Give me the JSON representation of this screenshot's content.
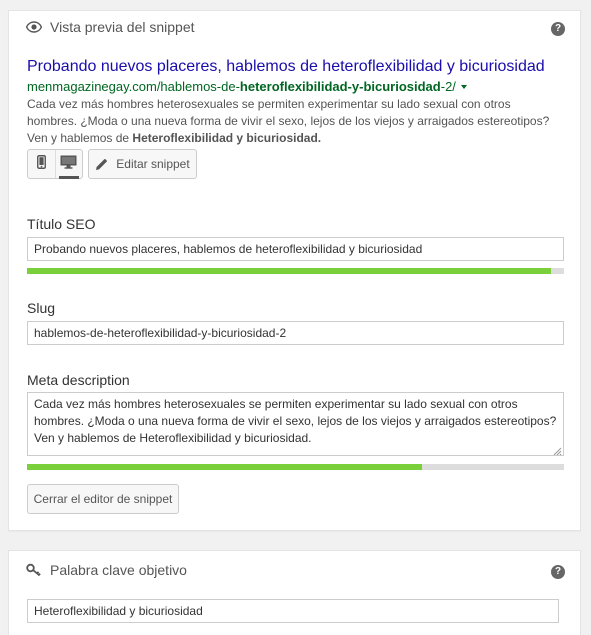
{
  "snippet_preview": {
    "header": "Vista previa del snippet",
    "help_label": "?",
    "title": "Probando nuevos placeres, hablemos de heteroflexibilidad y bicuriosidad",
    "url_prefix": "menmagazinegay.com/hablemos-de-",
    "url_bold": "heteroflexibilidad-y-bicuriosidad",
    "url_suffix": "-2/",
    "description_text": "Cada vez más hombres heterosexuales se permiten experimentar su lado sexual con otros hombres. ¿Moda o una nueva forma de vivir el sexo, lejos de los viejos y arraigados estereotipos? Ven y hablemos de ",
    "description_bold": "Heteroflexibilidad y bicuriosidad.",
    "mobile_icon": "mobile-icon",
    "desktop_icon": "desktop-icon",
    "active_mode": "desktop",
    "edit_label": "Editar snippet"
  },
  "editor": {
    "seo_title_label": "Título SEO",
    "seo_title_value": "Probando nuevos placeres, hablemos de heteroflexibilidad y bicuriosidad",
    "seo_title_progress": 0.975,
    "slug_label": "Slug",
    "slug_value": "hablemos-de-heteroflexibilidad-y-bicuriosidad-2",
    "meta_label": "Meta description",
    "meta_value": "Cada vez más hombres heterosexuales se permiten experimentar su lado sexual con otros hombres. ¿Moda o una nueva forma de vivir el sexo, lejos de los viejos y arraigados estereotipos? Ven y hablemos de Heteroflexibilidad y bicuriosidad.",
    "meta_progress": 0.736,
    "close_label": "Cerrar el editor de snippet"
  },
  "focus_keyword": {
    "header": "Palabra clave objetivo",
    "help_label": "?",
    "value": "Heteroflexibilidad y bicuriosidad"
  },
  "colors": {
    "title_link": "#1a0dab",
    "url_green": "#006621",
    "progress_good": "#7ad03a",
    "progress_track": "#dddddd"
  }
}
